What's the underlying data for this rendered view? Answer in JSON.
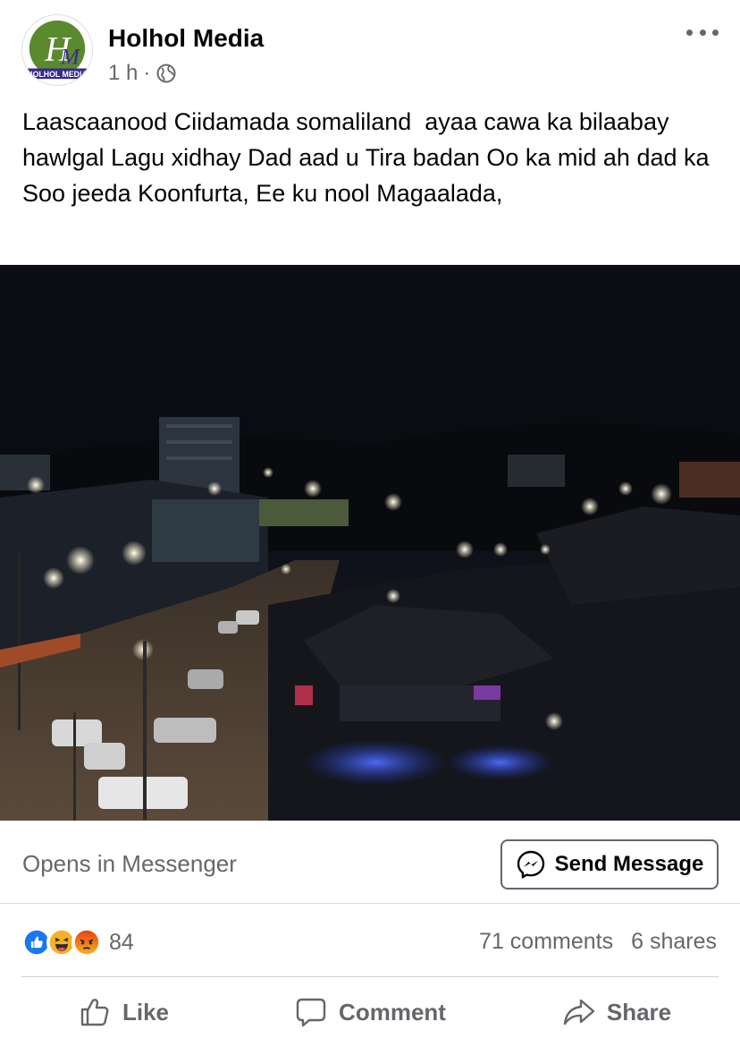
{
  "post": {
    "page_name": "Holhol Media",
    "time": "1 h",
    "separator": "·",
    "privacy_icon": "globe-icon",
    "more_icon": "more-horizontal-icon",
    "text": "Laascaanood Ciidamada somaliland  ayaa cawa ka bilaabay hawlgal Lagu xidhay Dad aad u Tira badan Oo ka mid ah dad ka Soo jeeda Koonfurta, Ee ku nool Magaalada,"
  },
  "avatar": {
    "logo_text": "HOLHOL MEDIA",
    "colors": {
      "green": "#5a8a2e",
      "purple": "#3a2a8c"
    }
  },
  "cta": {
    "label": "Opens in Messenger",
    "button_label": "Send Message",
    "button_icon": "messenger-icon"
  },
  "stats": {
    "reactions": [
      "like",
      "haha",
      "angry"
    ],
    "reaction_count": "84",
    "comments": "71 comments",
    "shares": "6 shares"
  },
  "actions": {
    "like": "Like",
    "comment": "Comment",
    "share": "Share"
  },
  "colors": {
    "text": "#050505",
    "secondary": "#65676b",
    "like_blue": "#1877f2",
    "haha_yellow": "#f7b125",
    "angry_orange": "#e9710f"
  }
}
